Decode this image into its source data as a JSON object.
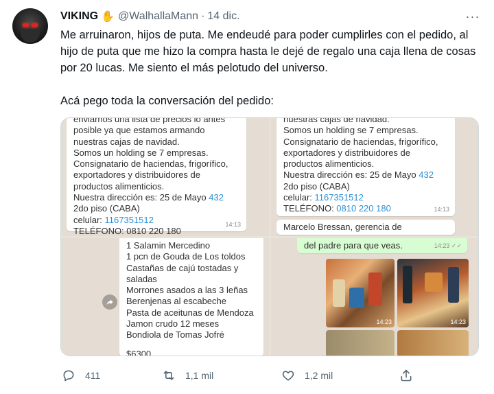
{
  "tweet": {
    "author_name": "VIKING",
    "author_emoji": "✋",
    "handle": "@WalhallaMann",
    "separator": "·",
    "date": "14 dic.",
    "more_label": "···",
    "paragraph_1": "Me arruinaron, hijos de puta. Me endeudé para poder cumplirles con el pedido, al hijo de puta que me hizo la compra hasta le dejé de regalo una caja llena de cosas por 20 lucas. Me siento el más pelotudo del universo.",
    "paragraph_2": "Acá pego toda la conversación del pedido:"
  },
  "media": {
    "panel_1": {
      "lines": [
        "enviarnos una lista de precios lo antes",
        "posible ya que estamos armando",
        "nuestras cajas de navidad.",
        "Somos un holding se 7 empresas.",
        "Consignatario de haciendas, frigorífico,",
        "exportadores y distribuidores de",
        "productos alimenticios."
      ],
      "address_prefix": "Nuestra dirección es: 25 de Mayo ",
      "address_number": "432",
      "floor": "2do piso (CABA)",
      "cell_label": "celular: ",
      "cell_number": "1167351512",
      "phone_label": "TELÉFONO: 0810 220 180",
      "time": "14:13"
    },
    "panel_2": {
      "lines": [
        "nuestras cajas de navidad.",
        "Somos un holding se 7 empresas.",
        "Consignatario de haciendas, frigorífico,",
        "exportadores y distribuidores de",
        "productos alimenticios."
      ],
      "address_prefix": "Nuestra dirección es: 25 de Mayo ",
      "address_number": "432",
      "floor": "2do piso (CABA)",
      "cell_label": "celular: ",
      "cell_number": "1167351512",
      "phone_prefix": "TELÉFONO: ",
      "phone_number": "0810 220 180",
      "time": "14:13",
      "next_message": "Marcelo Bressan, gerencia de"
    },
    "panel_3": {
      "lines": [
        "1 Salamin Mercedino",
        "1 pcn de Gouda de Los toldos",
        "Castañas de cajú tostadas y",
        "saladas",
        "Morrones asados a las 3 leñas",
        "Berenjenas al escabeche",
        "Pasta de aceitunas de Mendoza",
        "Jamon crudo 12 meses",
        "Bondiola de Tomas Jofré"
      ],
      "price": "$6300"
    },
    "panel_4": {
      "message": "del padre para que veas.",
      "time": "14:23",
      "photo_time_1": "14:23",
      "photo_time_2": "14:23"
    }
  },
  "actions": {
    "replies": "411",
    "retweets": "1,1 mil",
    "likes": "1,2 mil"
  },
  "colors": {
    "text": "#0f1419",
    "secondary": "#536471",
    "link": "#2a8fd6",
    "whatsapp_bg": "#e5ddd3",
    "outgoing_bubble": "#d9fdd3"
  }
}
